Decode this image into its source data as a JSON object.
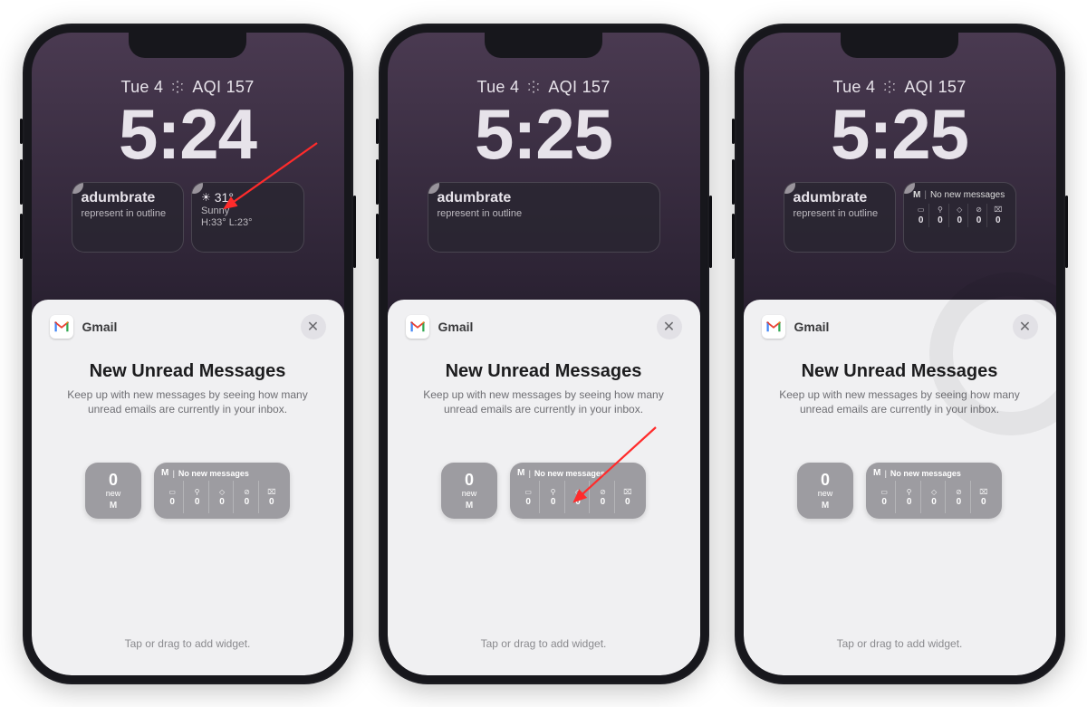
{
  "screens": [
    {
      "date_label": "Tue 4",
      "aqi_label": "AQI 157",
      "clock": "5:24",
      "widgets": {
        "mode": "two",
        "dict": {
          "word": "adumbrate",
          "def": "represent in outline"
        },
        "weather": {
          "temp": "31°",
          "cond": "Sunny",
          "hilo": "H:33° L:23°"
        }
      },
      "arrow": "weather"
    },
    {
      "date_label": "Tue 4",
      "aqi_label": "AQI 157",
      "clock": "5:25",
      "widgets": {
        "mode": "single",
        "dict": {
          "word": "adumbrate",
          "def": "represent in outline"
        }
      },
      "arrow": "option"
    },
    {
      "date_label": "Tue 4",
      "aqi_label": "AQI 157",
      "clock": "5:25",
      "widgets": {
        "mode": "two-gmail",
        "dict": {
          "word": "adumbrate",
          "def": "represent in outline"
        },
        "gmail": {
          "head": "No new messages",
          "counts": [
            "0",
            "0",
            "0",
            "0",
            "0"
          ]
        }
      },
      "arrow": null
    }
  ],
  "sheet": {
    "app": "Gmail",
    "title": "New Unread Messages",
    "desc": "Keep up with new messages by seeing how many unread emails are currently in your inbox.",
    "hint": "Tap or drag to add widget.",
    "small": {
      "count": "0",
      "label": "new"
    },
    "large": {
      "head": "No new messages",
      "counts": [
        "0",
        "0",
        "0",
        "0",
        "0"
      ]
    }
  },
  "icons": {
    "col_icons": [
      "▭",
      "⚲",
      "◇",
      "⊘",
      "⌧"
    ]
  }
}
